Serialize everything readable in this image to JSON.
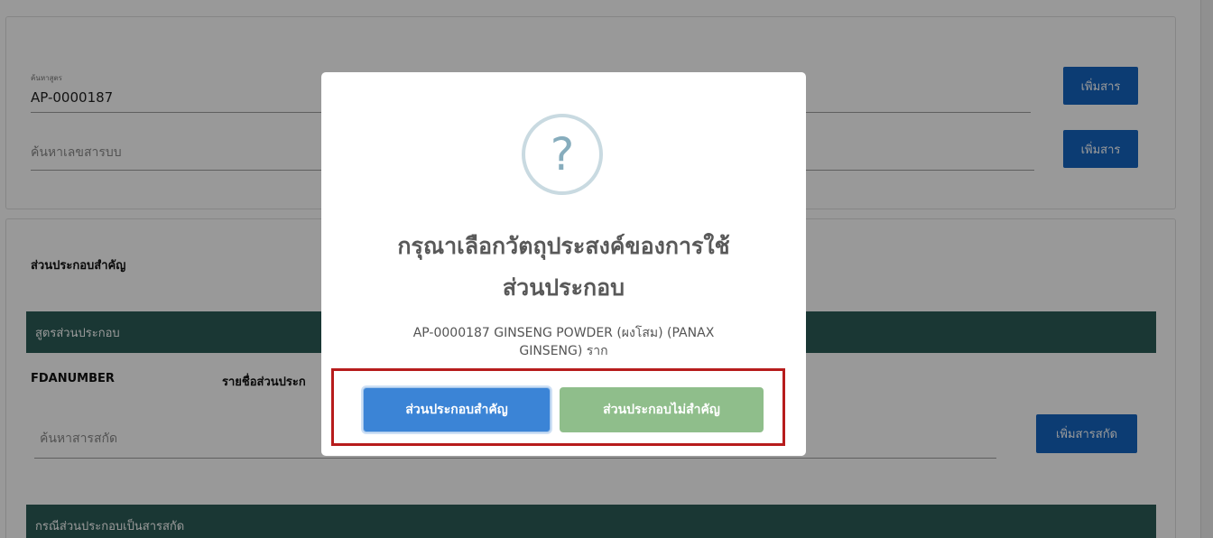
{
  "search": {
    "formula_label": "ค้นหาสูตร",
    "formula_value": "AP-0000187",
    "substance_placeholder": "ค้นหาเลขสารบบ",
    "add_button_1": "เพิ่มสาร",
    "add_button_2": "เพิ่มสาร"
  },
  "ingredients": {
    "heading": "ส่วนประกอบสำคัญ",
    "formula_bar": "สูตรส่วนประกอบ",
    "col_fdanumber": "FDANUMBER",
    "col_name": "รายชื่อส่วนประก",
    "extract_placeholder": "ค้นหาสารสกัด",
    "add_extract_button": "เพิ่มสารสกัด",
    "extract_bar": "กรณีส่วนประกอบเป็นสารสกัด"
  },
  "modal": {
    "icon": "question-icon",
    "title_line1": "กรุณาเลือกวัตถุประสงค์ของการใช้",
    "title_line2": "ส่วนประกอบ",
    "body_line1": "AP-0000187 GINSENG POWDER (ผงโสม) (PANAX",
    "body_line2": "GINSENG) ราก",
    "confirm_label": "ส่วนประกอบสำคัญ",
    "deny_label": "ส่วนประกอบไม่สำคัญ"
  },
  "colors": {
    "primary_blue": "#1565c0",
    "teal_header": "#2c5d57",
    "confirm_blue": "#3b84d6",
    "deny_green": "#8fbe8b",
    "highlight_red": "#b71c1c"
  }
}
